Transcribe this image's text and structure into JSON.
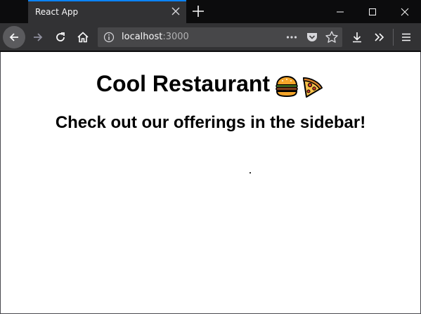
{
  "browser": {
    "tab": {
      "title": "React App"
    },
    "url": {
      "host": "localhost",
      "port": ":3000"
    },
    "icons": {
      "back": "back-arrow-icon",
      "forward": "forward-arrow-icon",
      "reload": "reload-icon",
      "home": "home-icon",
      "info": "info-icon",
      "page_actions": "ellipsis-icon",
      "pocket": "pocket-icon",
      "bookmark": "star-icon",
      "downloads": "download-icon",
      "overflow": "double-chevron-icon",
      "menu": "hamburger-icon",
      "tab_close": "close-icon",
      "new_tab": "plus-icon"
    },
    "colors": {
      "accent": "#0a84ff",
      "chrome": "#323234",
      "titlebar": "#0c0c0d"
    }
  },
  "page": {
    "title": "Cool Restaurant",
    "title_emojis": [
      "hamburger-icon",
      "pizza-icon"
    ],
    "subtitle": "Check out our offerings in the sidebar!"
  }
}
